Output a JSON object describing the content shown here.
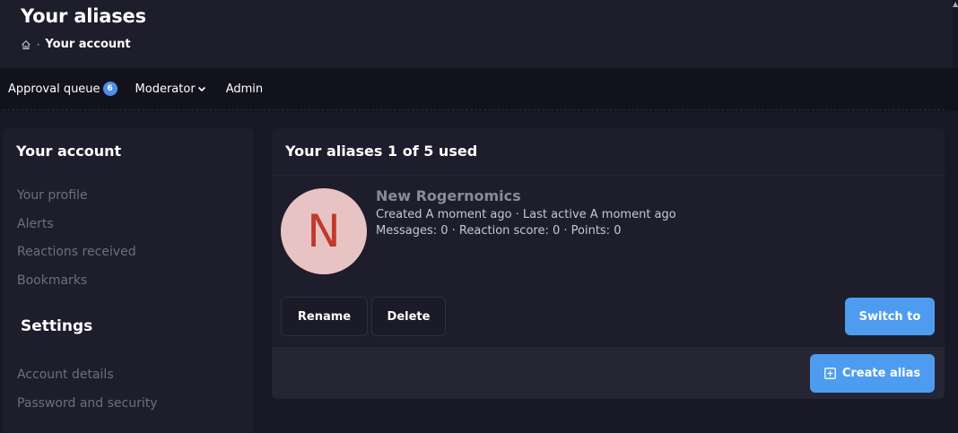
{
  "header": {
    "title": "Your aliases",
    "breadcrumb": {
      "home_icon": "home-icon",
      "separator": "·",
      "current": "Your account"
    }
  },
  "topnav": {
    "items": [
      {
        "label": "Approval queue",
        "badge": "6"
      },
      {
        "label": "Moderator",
        "icon": "chevron-down-icon"
      },
      {
        "label": "Admin"
      }
    ]
  },
  "sidebar": {
    "account_heading": "Your account",
    "account_items": [
      "Your profile",
      "Alerts",
      "Reactions received",
      "Bookmarks"
    ],
    "settings_heading": "Settings",
    "settings_items": [
      "Account details",
      "Password and security"
    ]
  },
  "panel": {
    "title": "Your aliases 1 of 5 used",
    "alias": {
      "avatar_letter": "N",
      "name": "New Rogernomics",
      "meta_line1": "Created A moment ago · Last active A moment ago",
      "meta_line2": "Messages: 0 · Reaction score: 0 · Points: 0"
    },
    "buttons": {
      "rename": "Rename",
      "delete": "Delete",
      "switch_to": "Switch to",
      "create_alias": "Create alias"
    }
  },
  "colors": {
    "accent": "#4e9cf0",
    "badge": "#4e8fea",
    "avatar_bg": "#e8c3c3",
    "avatar_letter": "#c0392b"
  }
}
